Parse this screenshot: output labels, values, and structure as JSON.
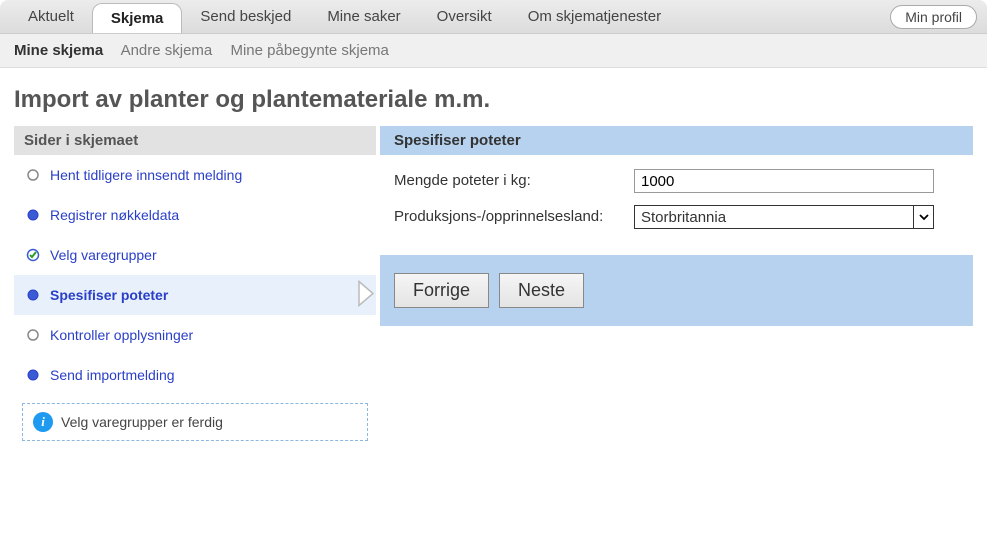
{
  "tabs": {
    "aktuelt": "Aktuelt",
    "skjema": "Skjema",
    "send_beskjed": "Send beskjed",
    "mine_saker": "Mine saker",
    "oversikt": "Oversikt",
    "om": "Om skjematjenester",
    "profil": "Min profil"
  },
  "subtabs": {
    "mine": "Mine skjema",
    "andre": "Andre skjema",
    "pabegynte": "Mine påbegynte skjema"
  },
  "page_title": "Import av planter og plantemateriale m.m.",
  "side_header": "Sider i skjemaet",
  "steps": {
    "s1": "Hent tidligere innsendt melding",
    "s2": "Registrer nøkkeldata",
    "s3": "Velg varegrupper",
    "s4": "Spesifiser poteter",
    "s5": "Kontroller opplysninger",
    "s6": "Send importmelding"
  },
  "info_message": "Velg varegrupper er ferdig",
  "main_header": "Spesifiser poteter",
  "form": {
    "qty_label": "Mengde poteter i kg:",
    "qty_value": "1000",
    "country_label": "Produksjons-/opprinnelsesland:",
    "country_value": "Storbritannia"
  },
  "buttons": {
    "prev": "Forrige",
    "next": "Neste"
  }
}
